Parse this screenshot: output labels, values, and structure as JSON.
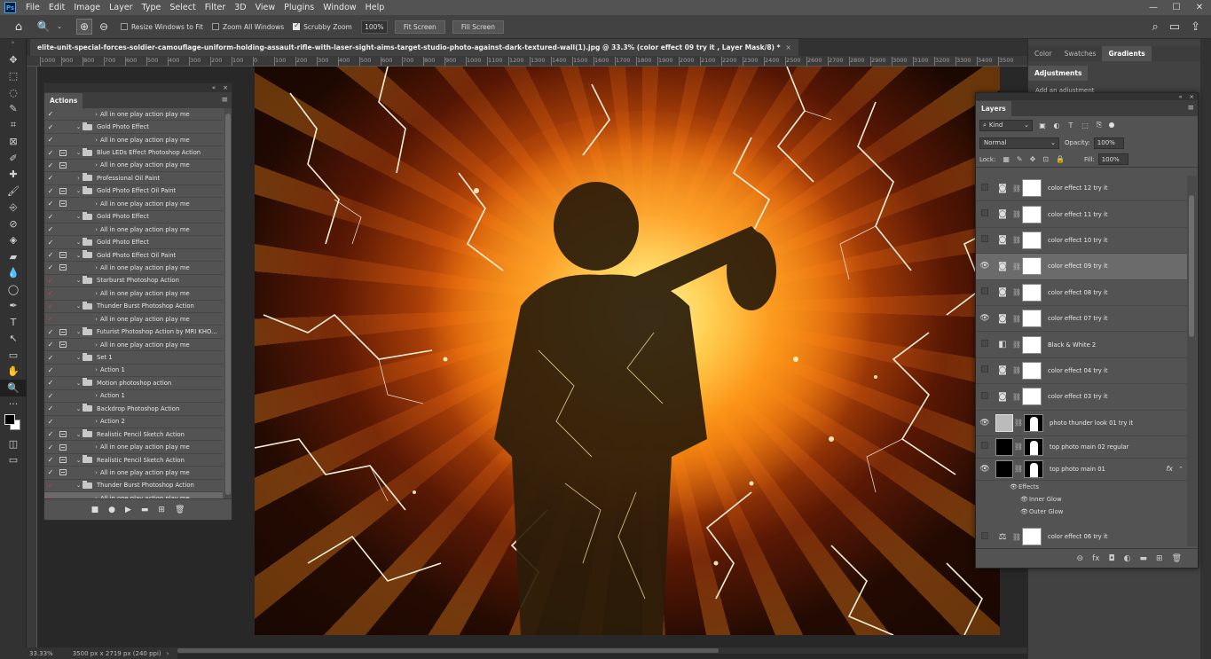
{
  "menubar": {
    "logo": "Ps",
    "items": [
      "File",
      "Edit",
      "Image",
      "Layer",
      "Type",
      "Select",
      "Filter",
      "3D",
      "View",
      "Plugins",
      "Window",
      "Help"
    ],
    "window_controls": [
      "—",
      "☐",
      "✕"
    ]
  },
  "options": {
    "resize_windows": "Resize Windows to Fit",
    "zoom_all": "Zoom All Windows",
    "scrubby_zoom": "Scrubby Zoom",
    "zoom_value": "100%",
    "fit_screen": "Fit Screen",
    "fill_screen": "Fill Screen"
  },
  "document": {
    "tab_title": "elite-unit-special-forces-soldier-camouflage-uniform-holding-assault-rifle-with-laser-sight-aims-target-studio-photo-against-dark-textured-wall(1).jpg @ 33.3% (color effect 09 try it , Layer Mask/8) *",
    "close": "×"
  },
  "ruler": {
    "ticks": [
      "1000",
      "900",
      "800",
      "700",
      "600",
      "500",
      "400",
      "300",
      "200",
      "100",
      "0",
      "100",
      "200",
      "300",
      "400",
      "500",
      "600",
      "700",
      "800",
      "900",
      "1000",
      "1100",
      "1200",
      "1300",
      "1400",
      "1500",
      "1600",
      "1700",
      "1800",
      "1900",
      "2000",
      "2100",
      "2200",
      "2300",
      "2400",
      "2500",
      "2600",
      "2700",
      "2800",
      "2900",
      "3000",
      "3100",
      "3200",
      "3300",
      "3400",
      "3500"
    ]
  },
  "status": {
    "zoom": "33.33%",
    "dims": "3500 px x 2719 px (240 ppi)",
    "arrow": "›"
  },
  "actions_panel": {
    "tab": "Actions",
    "collapse": "«",
    "close": "×",
    "menu": "≡",
    "rows": [
      {
        "check": "✓",
        "red": false,
        "dialog": false,
        "kind": "action",
        "label": "All in one play action play me"
      },
      {
        "check": "✓",
        "red": false,
        "dialog": false,
        "kind": "set",
        "label": "Gold Photo Effect"
      },
      {
        "check": "✓",
        "red": false,
        "dialog": false,
        "kind": "action",
        "label": "All in one play action play me"
      },
      {
        "check": "✓",
        "red": false,
        "dialog": true,
        "kind": "set",
        "label": "Blue LEDs Effect Photoshop Action"
      },
      {
        "check": "✓",
        "red": false,
        "dialog": true,
        "kind": "action",
        "label": "All in one play action play me"
      },
      {
        "check": "✓",
        "red": false,
        "dialog": false,
        "kind": "set-closed",
        "label": "Professional Oil Paint"
      },
      {
        "check": "✓",
        "red": false,
        "dialog": true,
        "kind": "set",
        "label": "Gold Photo Effect Oil Paint"
      },
      {
        "check": "✓",
        "red": false,
        "dialog": true,
        "kind": "action",
        "label": "All in one play action play me"
      },
      {
        "check": "✓",
        "red": false,
        "dialog": false,
        "kind": "set",
        "label": "Gold Photo Effect"
      },
      {
        "check": "✓",
        "red": false,
        "dialog": false,
        "kind": "action",
        "label": "All in one play action play me"
      },
      {
        "check": "✓",
        "red": false,
        "dialog": false,
        "kind": "set",
        "label": "Gold Photo Effect"
      },
      {
        "check": "✓",
        "red": false,
        "dialog": true,
        "kind": "set",
        "label": "Gold Photo Effect Oil Paint"
      },
      {
        "check": "✓",
        "red": false,
        "dialog": true,
        "kind": "action",
        "label": "All in one play action play me"
      },
      {
        "check": "✓",
        "red": true,
        "dialog": false,
        "kind": "set",
        "label": "Starburst Photoshop Action"
      },
      {
        "check": "✓",
        "red": true,
        "dialog": false,
        "kind": "action",
        "label": "All in one play action play me"
      },
      {
        "check": "✓",
        "red": true,
        "dialog": false,
        "kind": "set",
        "label": "Thunder Burst Photoshop Action"
      },
      {
        "check": "✓",
        "red": true,
        "dialog": false,
        "kind": "action",
        "label": "All in one play action play me"
      },
      {
        "check": "✓",
        "red": false,
        "dialog": true,
        "kind": "set",
        "label": "Futurist Photoshop Action by MRI KHO..."
      },
      {
        "check": "✓",
        "red": false,
        "dialog": true,
        "kind": "action",
        "label": "All in one play action play me"
      },
      {
        "check": "✓",
        "red": false,
        "dialog": false,
        "kind": "set",
        "label": "Set 1"
      },
      {
        "check": "✓",
        "red": false,
        "dialog": false,
        "kind": "action",
        "label": "Action 1"
      },
      {
        "check": "✓",
        "red": false,
        "dialog": false,
        "kind": "set",
        "label": "Motion photoshop action"
      },
      {
        "check": "✓",
        "red": false,
        "dialog": false,
        "kind": "action",
        "label": "Action 1"
      },
      {
        "check": "✓",
        "red": false,
        "dialog": false,
        "kind": "set",
        "label": "Backdrop Photoshop Action"
      },
      {
        "check": "✓",
        "red": false,
        "dialog": false,
        "kind": "action",
        "label": "Action 2"
      },
      {
        "check": "✓",
        "red": false,
        "dialog": true,
        "kind": "set",
        "label": "Realistic Pencil Sketch Action"
      },
      {
        "check": "✓",
        "red": false,
        "dialog": true,
        "kind": "action",
        "label": "All in one play action play me"
      },
      {
        "check": "✓",
        "red": false,
        "dialog": true,
        "kind": "set",
        "label": "Realistic Pencil Sketch Action"
      },
      {
        "check": "✓",
        "red": false,
        "dialog": true,
        "kind": "action",
        "label": "All in one play action play me"
      },
      {
        "check": "✓",
        "red": true,
        "dialog": false,
        "kind": "set",
        "label": "Thunder Burst Photoshop Action"
      },
      {
        "check": "✓",
        "red": true,
        "dialog": false,
        "kind": "action-selected",
        "label": "All in one play action play me"
      }
    ],
    "footer": [
      "■",
      "●",
      "▶",
      "▬",
      "⊞",
      "🗑"
    ]
  },
  "right_panels": {
    "tabs": [
      "Color",
      "Swatches",
      "Gradients"
    ],
    "adjustments_tab": "Adjustments",
    "adjustments_text": "Add an adjustment"
  },
  "layers_panel": {
    "tab": "Layers",
    "menu": "≡",
    "kind": "Kind",
    "blend_mode": "Normal",
    "opacity_label": "Opacity:",
    "opacity": "100%",
    "lock_label": "Lock:",
    "fill_label": "Fill:",
    "fill": "100%",
    "layers": [
      {
        "name": "color effect 12 try it",
        "visible": false,
        "type": "adj",
        "icon": "◙"
      },
      {
        "name": "color effect 11 try it",
        "visible": false,
        "type": "adj",
        "icon": "◙"
      },
      {
        "name": "color effect 10 try it",
        "visible": false,
        "type": "adj",
        "icon": "◙"
      },
      {
        "name": "color effect 09 try it",
        "visible": true,
        "type": "adj",
        "icon": "◙",
        "selected": true
      },
      {
        "name": "color effect 08 try it",
        "visible": false,
        "type": "adj",
        "icon": "◙"
      },
      {
        "name": "color effect 07 try it",
        "visible": true,
        "type": "adj",
        "icon": "◙"
      },
      {
        "name": "Black & White 2",
        "visible": false,
        "type": "adj",
        "icon": "◧"
      },
      {
        "name": "color effect 04 try it",
        "visible": false,
        "type": "adj",
        "icon": "◙"
      },
      {
        "name": "color effect 03 try it",
        "visible": false,
        "type": "adj",
        "icon": "◙"
      },
      {
        "name": "photo thunder look 01 try it",
        "visible": true,
        "type": "smart"
      },
      {
        "name": "top photo main 02 regular",
        "visible": false,
        "type": "photo"
      },
      {
        "name": "top photo main 01",
        "visible": true,
        "type": "photo",
        "fx": "fx"
      }
    ],
    "effects_label": "Effects",
    "effects": [
      "Inner Glow",
      "Outer Glow"
    ],
    "after_layer": {
      "name": "color effect 06 try it",
      "visible": false,
      "type": "adj",
      "icon": "⚖"
    },
    "footer": [
      "⊖",
      "fx",
      "◘",
      "◐",
      "▬",
      "⊞",
      "🗑"
    ]
  },
  "toolbar": {
    "tools": [
      "✥",
      "⬚",
      "◌",
      "✎",
      "⌗",
      "⊠",
      "✐",
      "✚",
      "🖌",
      "⎆",
      "⊘",
      "◈",
      "▰",
      "💧",
      "◯",
      "✒",
      "T",
      "↖",
      "▭",
      "✋",
      "🔍",
      "···"
    ]
  },
  "colors": {
    "accent": "#31a8ff",
    "panel": "#535353",
    "background": "#282828"
  }
}
